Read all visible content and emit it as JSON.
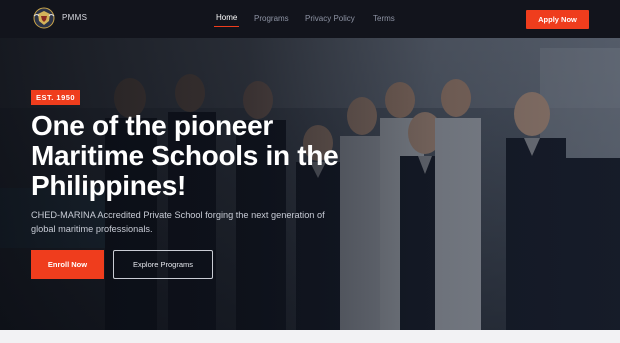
{
  "nav": {
    "brand": "PMMS",
    "logo_icon": "school-crest-icon",
    "links": [
      {
        "label": "Home",
        "active": true
      },
      {
        "label": "Programs",
        "active": false
      },
      {
        "label": "Privacy Policy",
        "active": false
      },
      {
        "label": "Terms",
        "active": false
      }
    ],
    "apply_label": "Apply Now"
  },
  "hero": {
    "badge": "EST. 1950",
    "title": "One of the pioneer Maritime Schools in the Philippines!",
    "subtitle": "CHED-MARINA Accredited Private School forging the next generation of global maritime professionals.",
    "enroll_label": "Enroll Now",
    "explore_label": "Explore Programs"
  },
  "colors": {
    "accent": "#ef3d1d",
    "nav_bg": "#12141c"
  }
}
